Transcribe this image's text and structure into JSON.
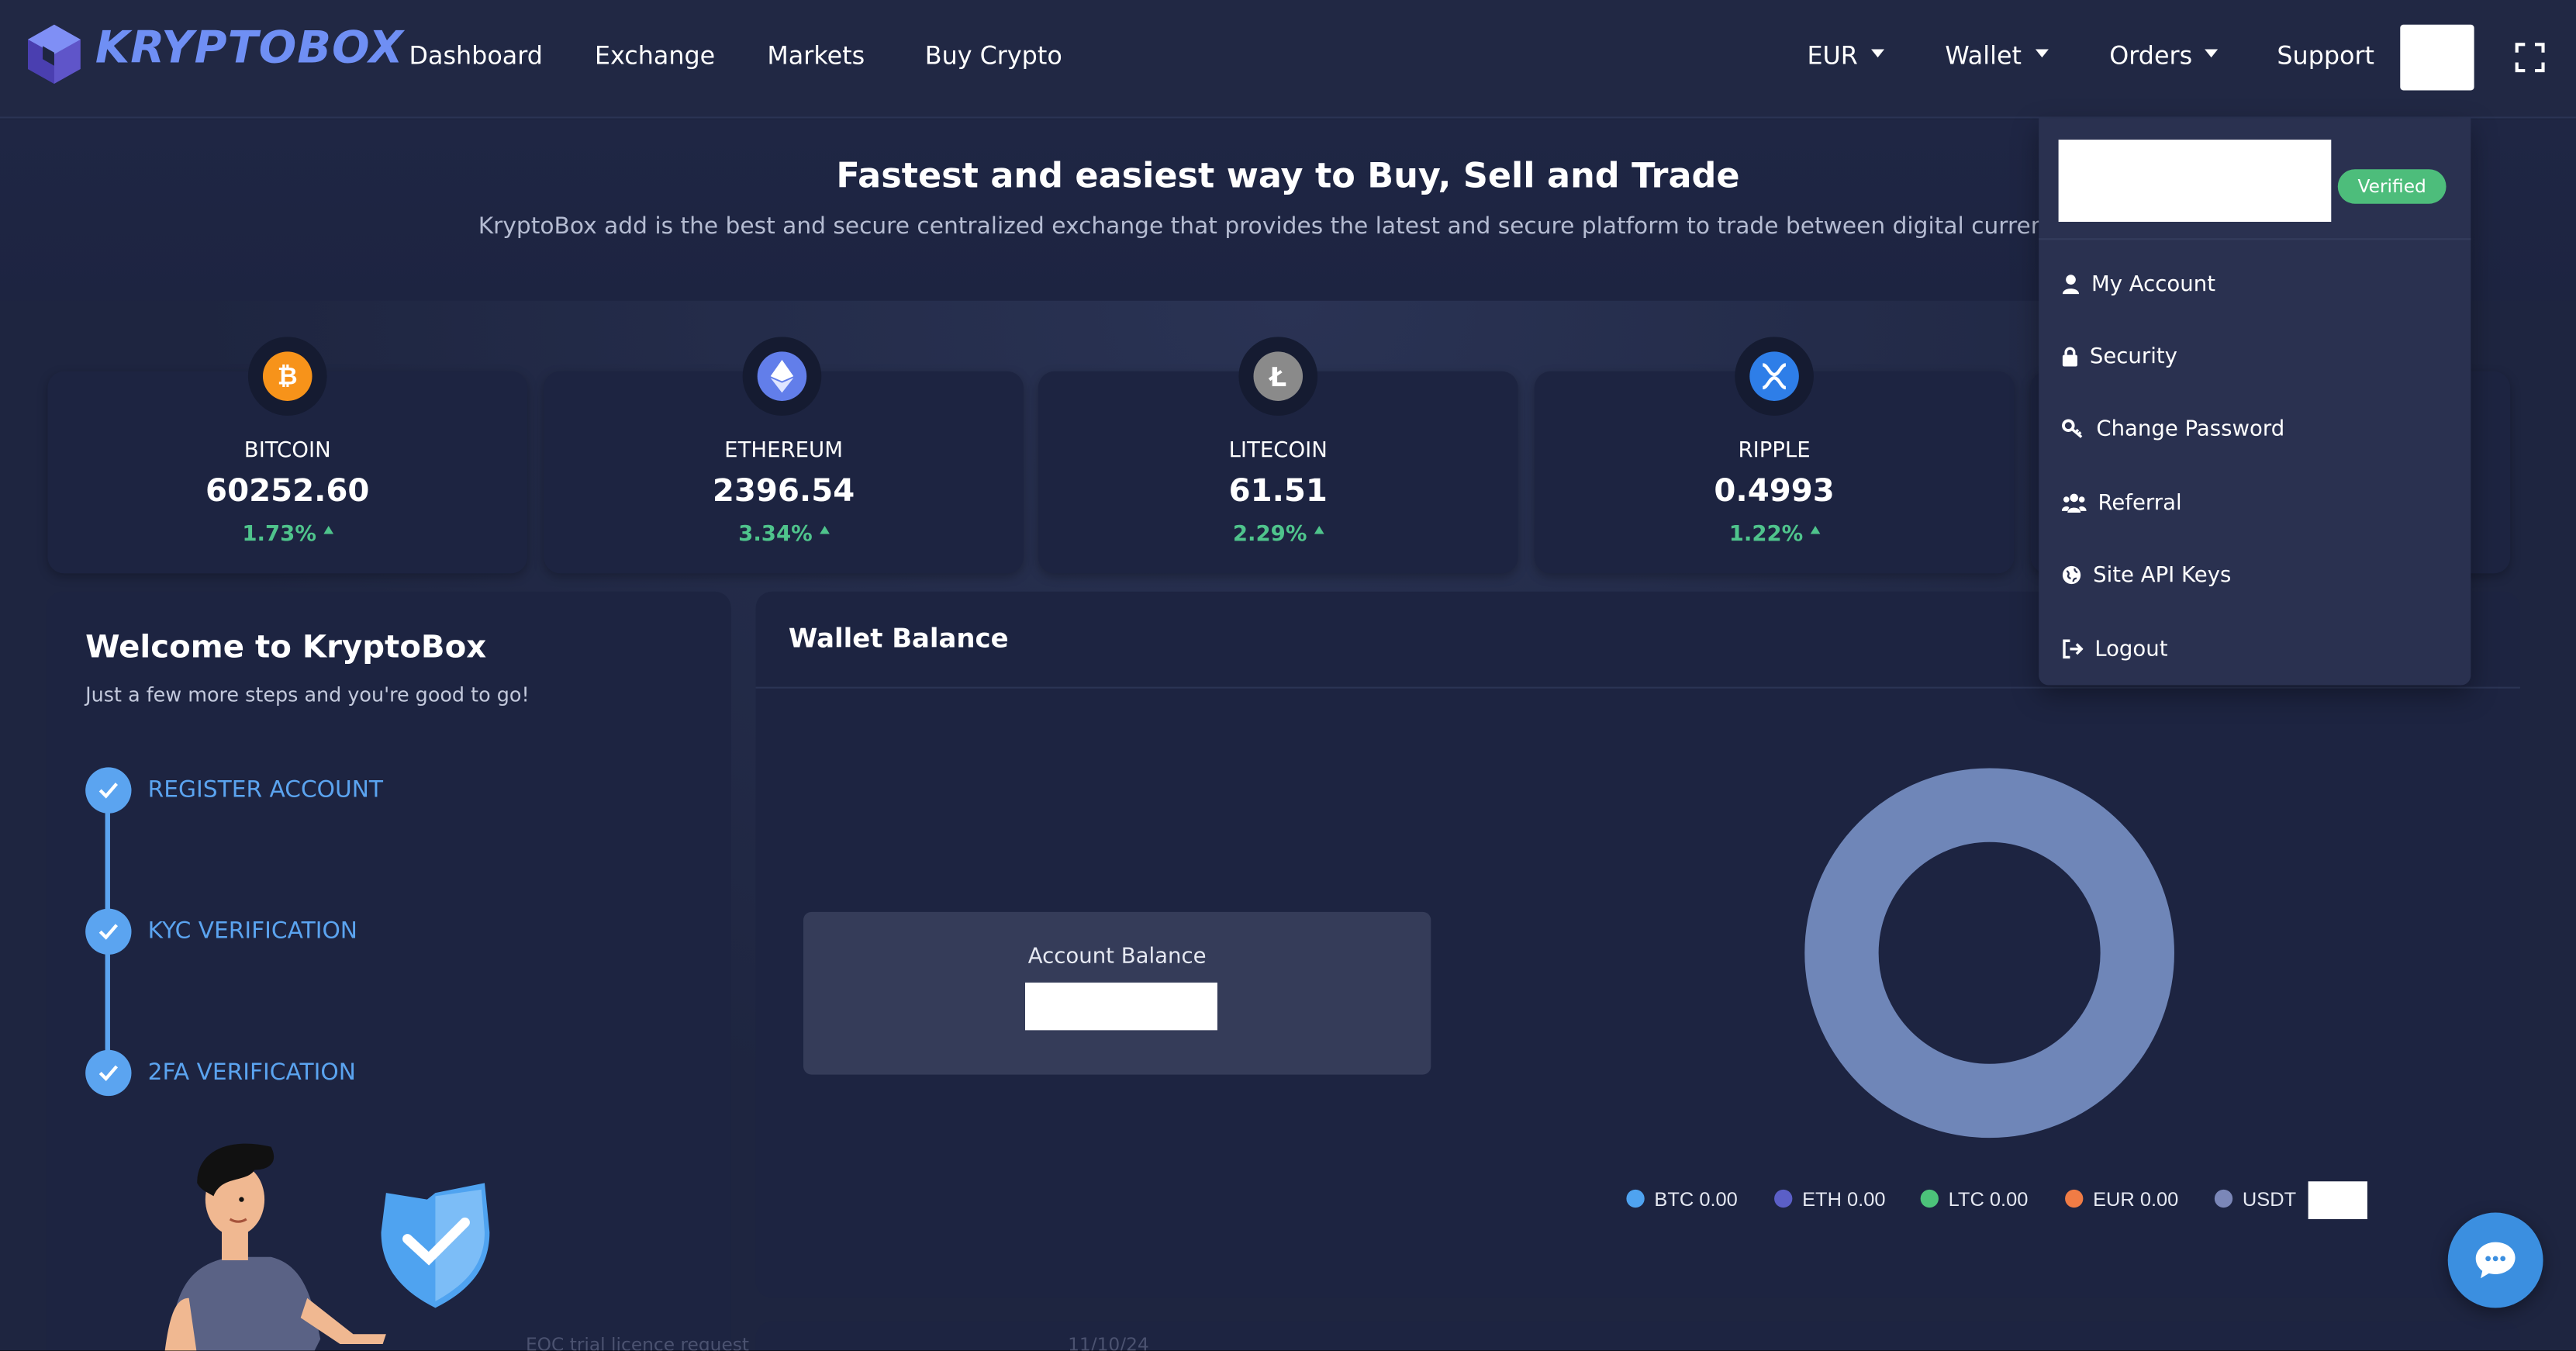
{
  "brand": {
    "name": "KRYPTOBOX"
  },
  "nav": {
    "links": [
      "Dashboard",
      "Exchange",
      "Markets",
      "Buy Crypto"
    ],
    "currency": "EUR",
    "wallet": "Wallet",
    "orders": "Orders",
    "support": "Support"
  },
  "hero": {
    "title": "Fastest and easiest way to Buy, Sell and Trade",
    "subtitle": "KryptoBox add is the best and secure centralized exchange that provides the latest and secure platform to trade between digital currencies."
  },
  "tickers": [
    {
      "name": "BITCOIN",
      "price": "60252.60",
      "change": "1.73%",
      "icon": "bitcoin-icon",
      "color": "#f7931a"
    },
    {
      "name": "ETHEREUM",
      "price": "2396.54",
      "change": "3.34%",
      "icon": "ethereum-icon",
      "color": "#627eea"
    },
    {
      "name": "LITECOIN",
      "price": "61.51",
      "change": "2.29%",
      "icon": "litecoin-icon",
      "color": "#8a8a8a"
    },
    {
      "name": "RIPPLE",
      "price": "0.4993",
      "change": "1.22%",
      "icon": "ripple-icon",
      "color": "#2e7ee8"
    }
  ],
  "welcome": {
    "title": "Welcome to KryptoBox",
    "subtitle": "Just a few more steps and you're good to go!",
    "steps": [
      "REGISTER ACCOUNT",
      "KYC VERIFICATION",
      "2FA VERIFICATION"
    ]
  },
  "wallet": {
    "title": "Wallet Balance",
    "account_balance_label": "Account Balance",
    "legend": [
      {
        "label": "BTC 0.00",
        "color": "#4fa3f0"
      },
      {
        "label": "ETH 0.00",
        "color": "#5b5fc7"
      },
      {
        "label": "LTC 0.00",
        "color": "#4cc37a"
      },
      {
        "label": "EUR 0.00",
        "color": "#f07c45"
      },
      {
        "label": "USDT",
        "color": "#7b87b8"
      }
    ],
    "donut_color": "#6f86b8"
  },
  "dropdown": {
    "badge": "Verified",
    "items": [
      "My Account",
      "Security",
      "Change Password",
      "Referral",
      "Site API Keys",
      "Logout"
    ]
  },
  "bottom": {
    "text": "EOC trial licence request",
    "date": "11/10/24"
  },
  "colors": {
    "accent": "#5ba4f0",
    "positive": "#4fc48c",
    "verified": "#4dbd7b",
    "background": "#1e2540"
  }
}
